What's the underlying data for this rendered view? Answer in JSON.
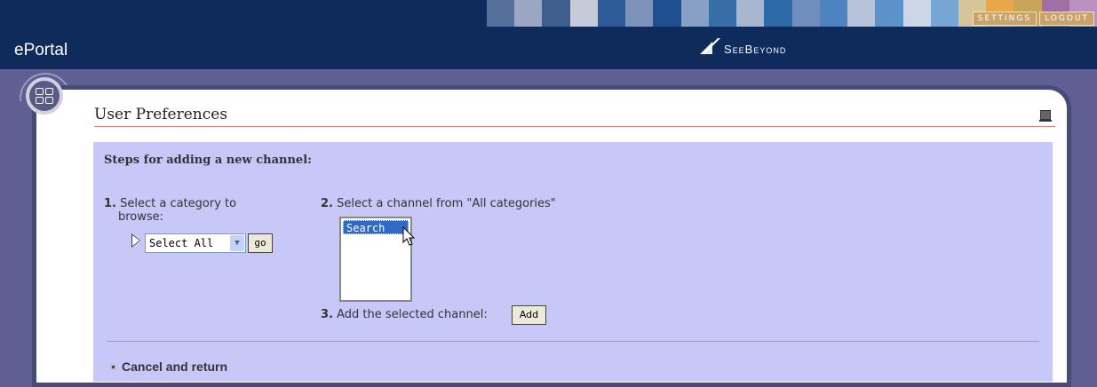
{
  "header": {
    "app_title": "ePortal",
    "brand": "SeeBeyond",
    "settings_label": "SETTINGS",
    "logout_label": "LOGOUT",
    "strip_colors": [
      "#56709c",
      "#9aa6c2",
      "#3f5e8e",
      "#c6cbd9",
      "#2f5a9a",
      "#7e93b9",
      "#1f4f8f",
      "#8a9fc4",
      "#366fa7",
      "#a8b6d0",
      "#2d6aa8",
      "#6f8dbd",
      "#4d84bf",
      "#b7c3d9",
      "#5a92c9",
      "#cdd6e6",
      "#77a6d4",
      "#d7c59a",
      "#e6a84a",
      "#c9a45b",
      "#9f6fa6",
      "#ba8fc2"
    ]
  },
  "panel": {
    "title": "User Preferences",
    "steps_heading": "Steps for adding a new channel:",
    "step1_num": "1.",
    "step1_text": "Select a category to",
    "step1_text2": "browse:",
    "category_select_value": "Select All",
    "go_label": "go",
    "step2_num": "2.",
    "step2_text": "Select a channel from \"All categories\"",
    "channels": [
      "Search"
    ],
    "step3_num": "3.",
    "step3_text": "Add the selected channel:",
    "add_label": "Add",
    "cancel_label": "Cancel and return"
  },
  "colors": {
    "header_bg": "#0f2b5c",
    "page_bg": "#5f5f93",
    "content_bg": "#c8c8f8",
    "title_rule": "#d88080",
    "selection": "#316ac5"
  }
}
